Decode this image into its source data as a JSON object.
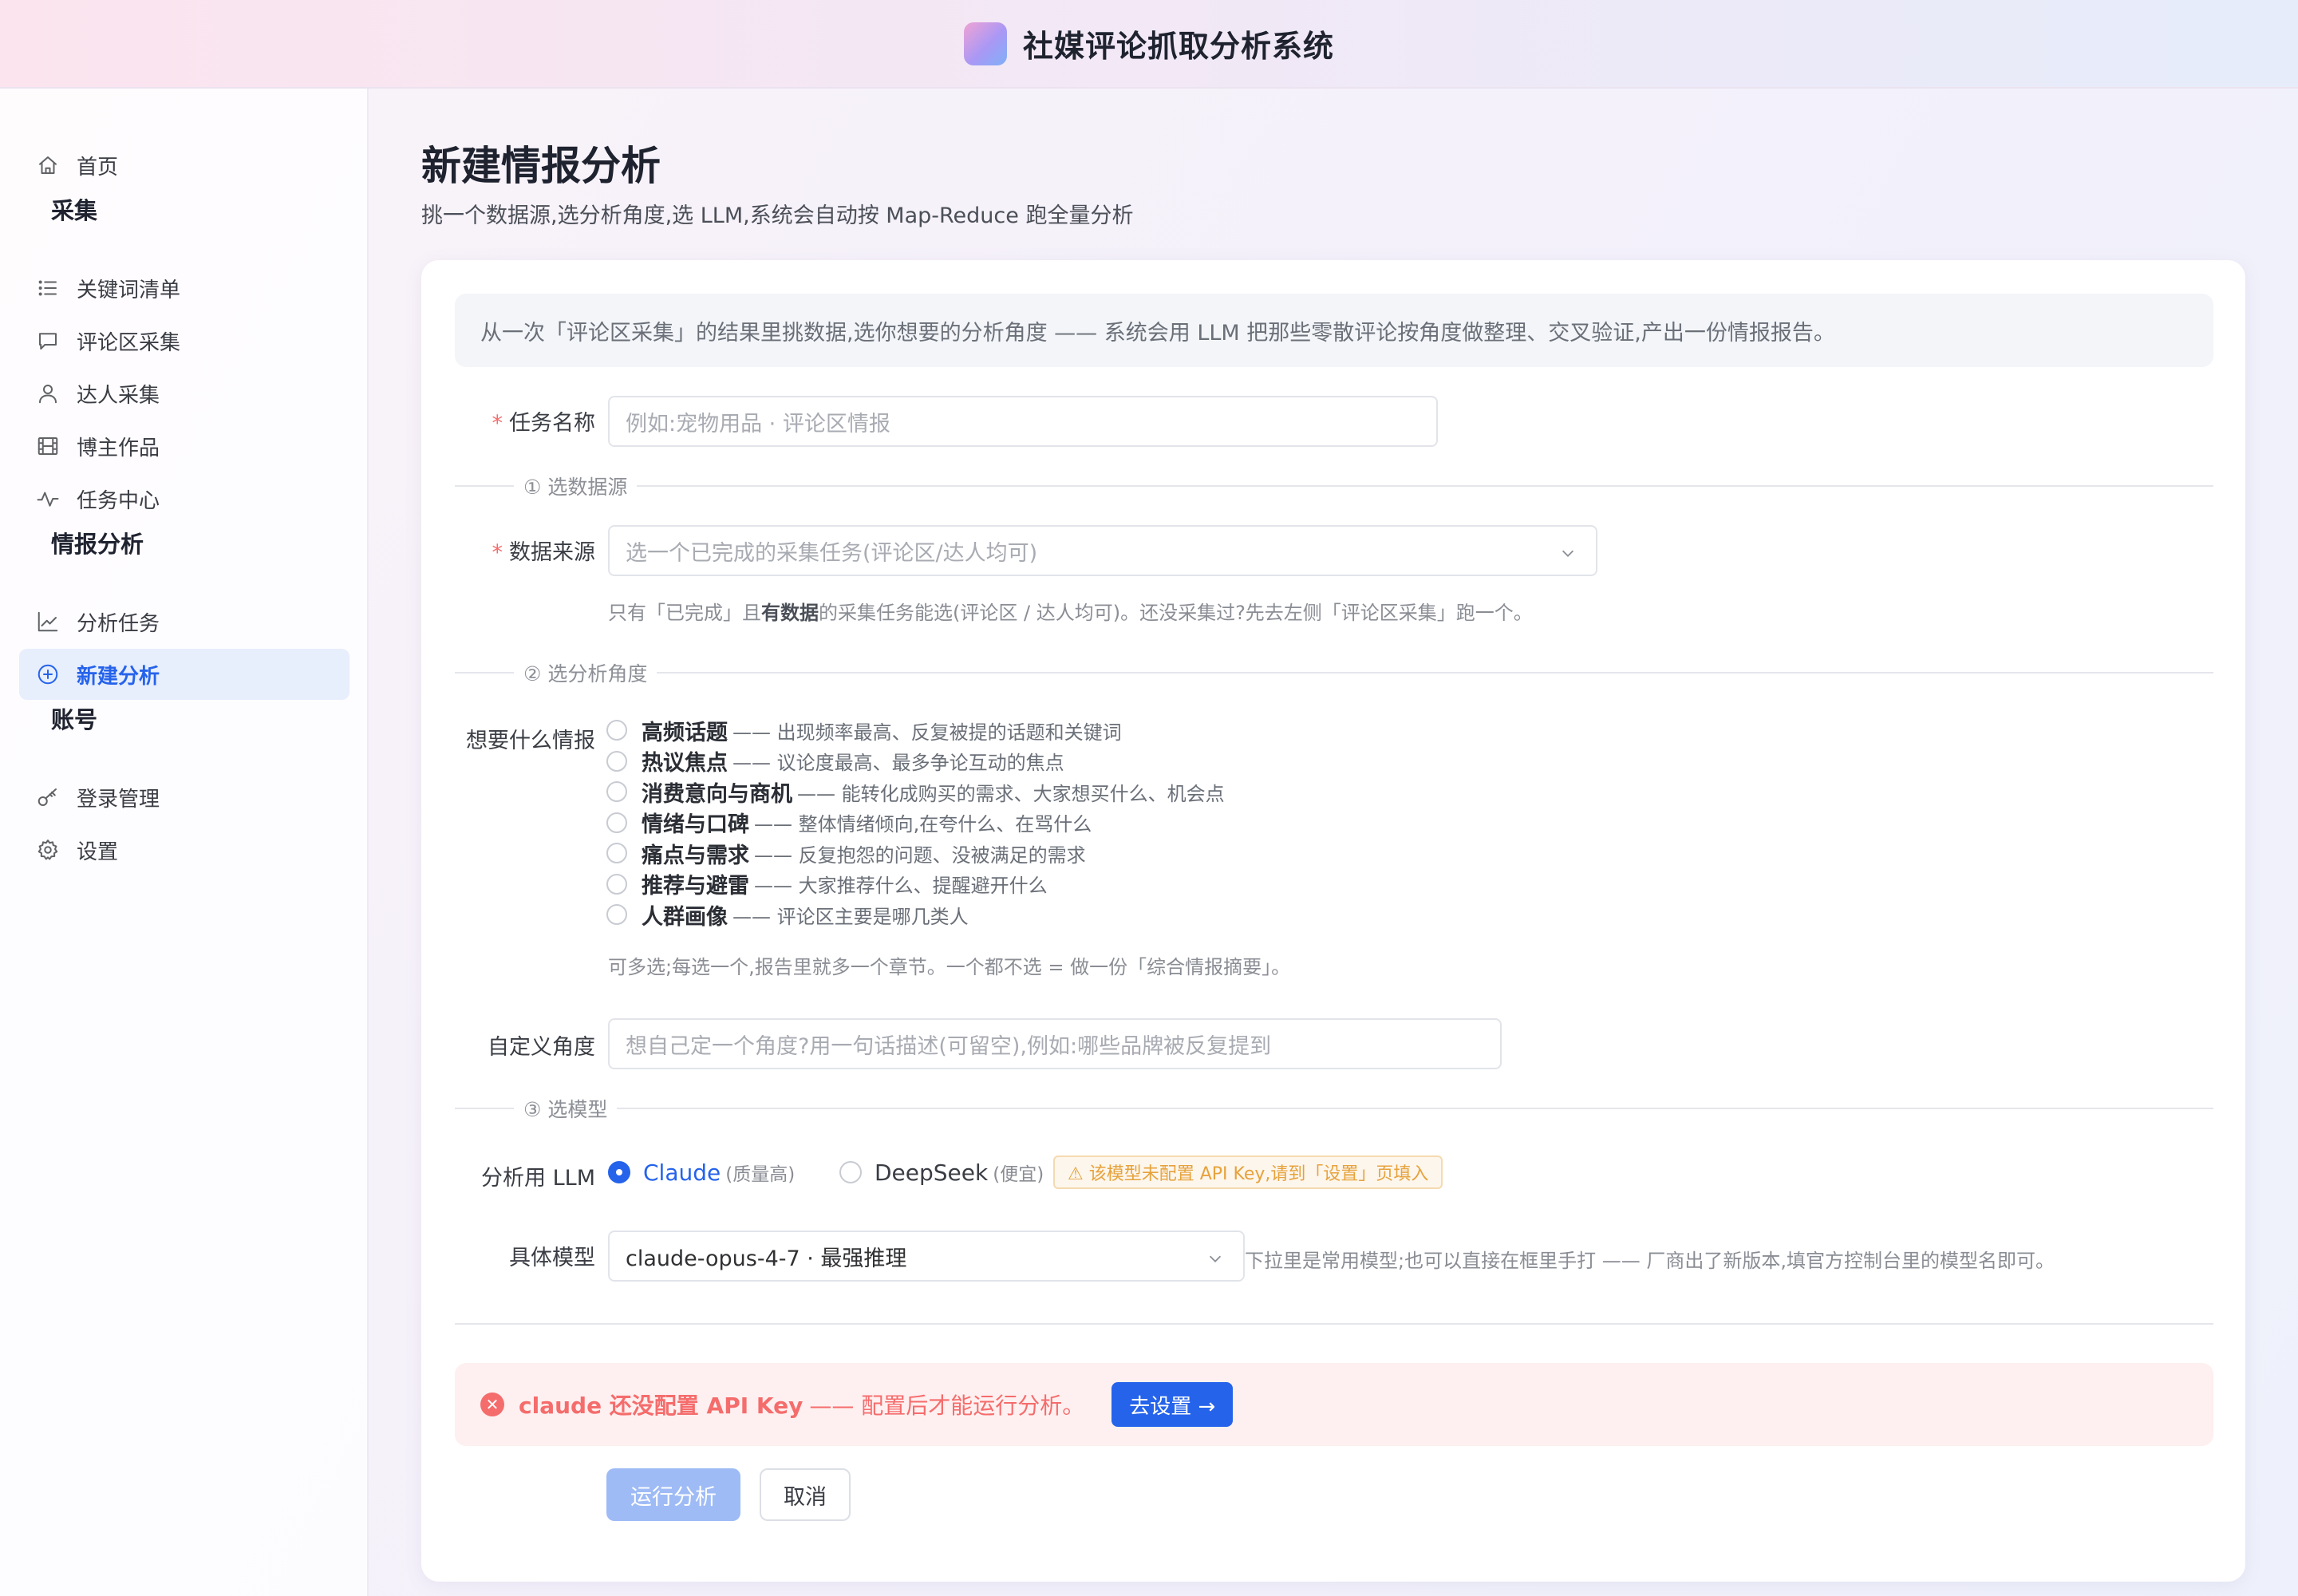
{
  "app": {
    "title": "社媒评论抓取分析系统"
  },
  "sidebar": {
    "home": "首页",
    "groups": {
      "collect": "采集",
      "intel": "情报分析",
      "account": "账号"
    },
    "items": {
      "keywords": "关键词清单",
      "comments": "评论区采集",
      "influencer": "达人采集",
      "works": "博主作品",
      "tasks": "任务中心",
      "analysis_tasks": "分析任务",
      "new_analysis": "新建分析",
      "login": "登录管理",
      "settings": "设置"
    }
  },
  "page": {
    "title": "新建情报分析",
    "subtitle": "挑一个数据源,选分析角度,选 LLM,系统会自动按 Map-Reduce 跑全量分析"
  },
  "form": {
    "intro": "从一次「评论区采集」的结果里挑数据,选你想要的分析角度 —— 系统会用 LLM 把那些零散评论按角度做整理、交叉验证,产出一份情报报告。",
    "task_name": {
      "label": "任务名称",
      "placeholder": "例如:宠物用品 · 评论区情报"
    },
    "section1": "① 选数据源",
    "source": {
      "label": "数据来源",
      "placeholder": "选一个已完成的采集任务(评论区/达人均可)",
      "hint_pre": "只有「已完成」且",
      "hint_bold": "有数据",
      "hint_post": "的采集任务能选(评论区 / 达人均可)。还没采集过?先去左侧「评论区采集」跑一个。"
    },
    "section2": "② 选分析角度",
    "angles": {
      "label": "想要什么情报",
      "options": [
        {
          "title": "高频话题",
          "desc": "—— 出现频率最高、反复被提的话题和关键词"
        },
        {
          "title": "热议焦点",
          "desc": "—— 议论度最高、最多争论互动的焦点"
        },
        {
          "title": "消费意向与商机",
          "desc": "—— 能转化成购买的需求、大家想买什么、机会点"
        },
        {
          "title": "情绪与口碑",
          "desc": "—— 整体情绪倾向,在夸什么、在骂什么"
        },
        {
          "title": "痛点与需求",
          "desc": "—— 反复抱怨的问题、没被满足的需求"
        },
        {
          "title": "推荐与避雷",
          "desc": "—— 大家推荐什么、提醒避开什么"
        },
        {
          "title": "人群画像",
          "desc": "—— 评论区主要是哪几类人"
        }
      ],
      "hint": "可多选;每选一个,报告里就多一个章节。一个都不选 = 做一份「综合情报摘要」。"
    },
    "custom": {
      "label": "自定义角度",
      "placeholder": "想自己定一个角度?用一句话描述(可留空),例如:哪些品牌被反复提到"
    },
    "section3": "③ 选模型",
    "llm": {
      "label": "分析用 LLM",
      "claude": "Claude",
      "claude_note": "(质量高)",
      "deepseek": "DeepSeek",
      "deepseek_note": "(便宜)",
      "warning": "⚠ 该模型未配置 API Key,请到「设置」页填入",
      "selected": "Claude"
    },
    "model": {
      "label": "具体模型",
      "value": "claude-opus-4-7 · 最强推理",
      "hint": "下拉里是常用模型;也可以直接在框里手打 —— 厂商出了新版本,填官方控制台里的模型名即可。"
    },
    "alert": {
      "strong": "claude 还没配置 API Key",
      "text": "—— 配置后才能运行分析。",
      "button": "去设置 →"
    },
    "buttons": {
      "run": "运行分析",
      "cancel": "取消"
    }
  },
  "colors": {
    "accent": "#2563eb",
    "danger": "#f56c6c",
    "warning": "#e6a23c"
  }
}
